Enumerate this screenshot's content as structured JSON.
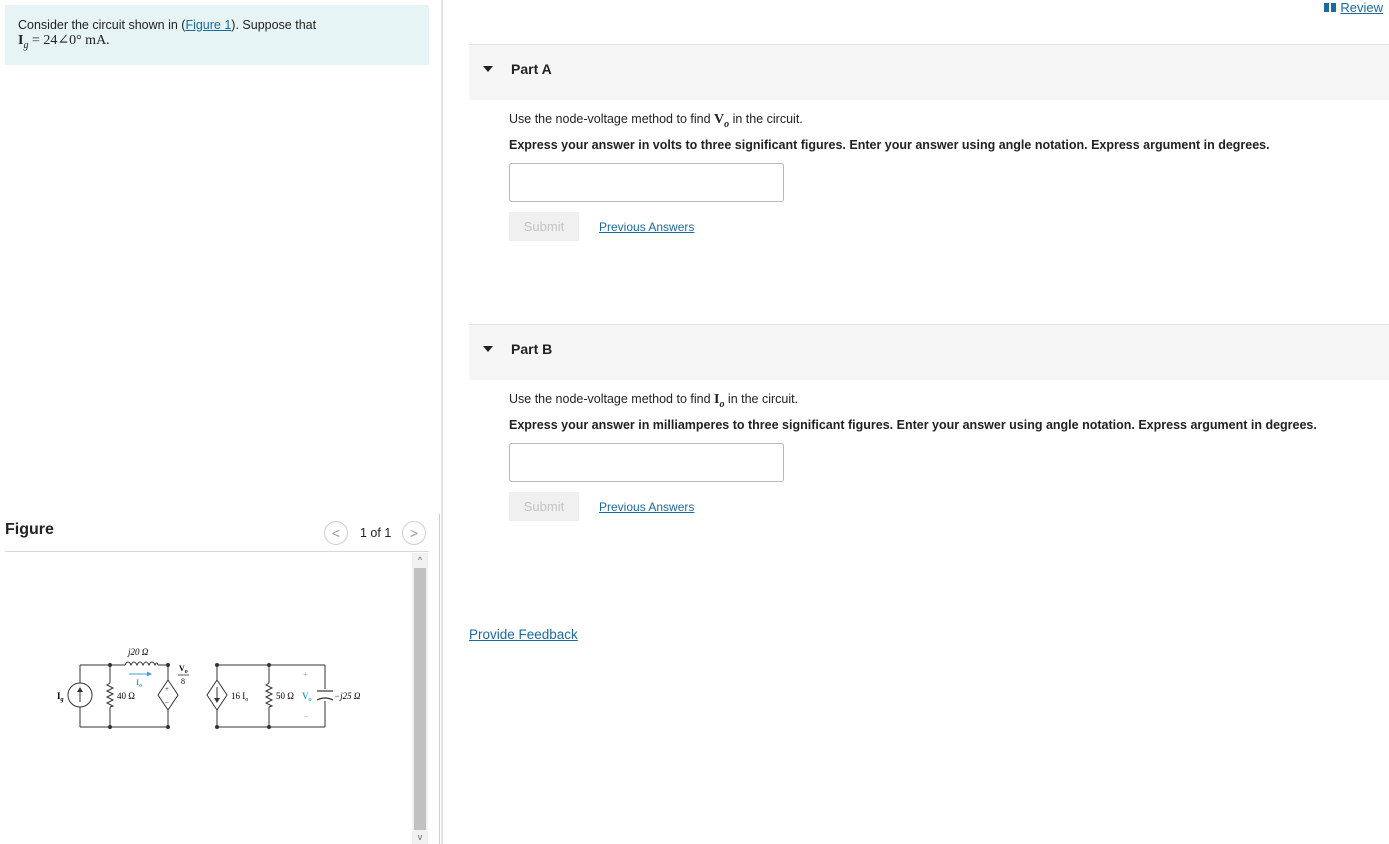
{
  "problem": {
    "text_before": "Consider the circuit shown in (",
    "figure_link": "Figure 1",
    "text_after": "). Suppose that",
    "current_symbol": "I",
    "current_subscript": "g",
    "current_value": " = 24∠0° mA."
  },
  "figure": {
    "title": "Figure",
    "pager": "1 of 1",
    "prev_glyph": "<",
    "next_glyph": ">",
    "scroll_up_glyph": "^",
    "scroll_down_glyph": "v",
    "circuit_labels": {
      "source": "I",
      "source_sub": "g",
      "r40": "40 Ω",
      "l20": "j20 Ω",
      "io": "I",
      "io_sub": "o",
      "vo_num": "V",
      "vo_num_sub": "o",
      "vo_den": "8",
      "dep_source": "16 I",
      "dep_source_sub": "o",
      "r50": "50 Ω",
      "vo": "V",
      "vo_sub": "o",
      "cap": "−j25 Ω",
      "plus": "+",
      "minus": "−"
    }
  },
  "header": {
    "review_label": "Review"
  },
  "partA": {
    "title": "Part A",
    "instr_before": "Use the node-voltage method to find ",
    "instr_symbol": "V",
    "instr_sub": "o",
    "instr_after": " in the circuit.",
    "express": "Express your answer in volts to three significant figures. Enter your answer using angle notation. Express argument in degrees.",
    "submit": "Submit",
    "previous": "Previous Answers"
  },
  "partB": {
    "title": "Part B",
    "instr_before": "Use the node-voltage method to find ",
    "instr_symbol": "I",
    "instr_sub": "o",
    "instr_after": " in the circuit.",
    "express": "Express your answer in milliamperes to three significant figures. Enter your answer using angle notation. Express argument in degrees.",
    "submit": "Submit",
    "previous": "Previous Answers"
  },
  "feedback": {
    "label": "Provide Feedback"
  },
  "colors": {
    "link": "#1a6aa0",
    "problem_bg": "#e6f4f6",
    "part_header_bg": "#f6f6f6",
    "circuit_accent": "#3aa0d8"
  }
}
